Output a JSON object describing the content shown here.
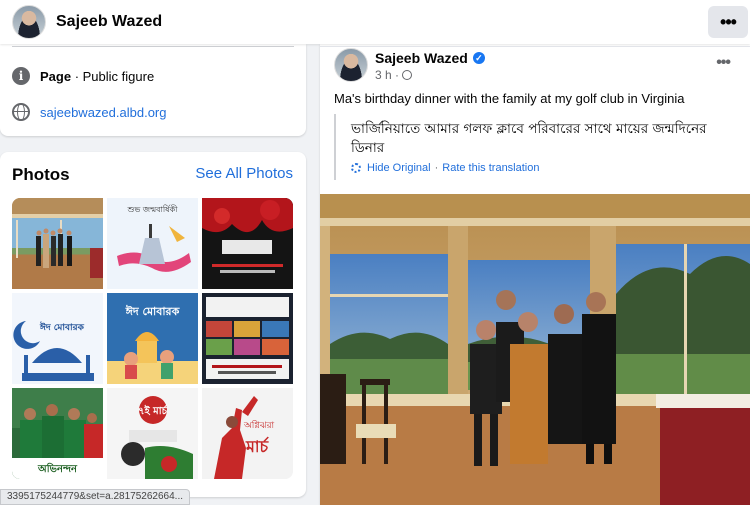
{
  "header": {
    "name": "Sajeeb Wazed",
    "more_label": "•••"
  },
  "intro": {
    "category_label": "Page",
    "category_value": "Public figure",
    "separator": " · ",
    "website": "sajeebwazed.albd.org"
  },
  "photos": {
    "title": "Photos",
    "see_all": "See All Photos",
    "tiles": [
      {
        "name": "photo-family-dinner"
      },
      {
        "name": "photo-birthday-illustration"
      },
      {
        "name": "photo-red-poster"
      },
      {
        "name": "photo-eid-mubarak-mosque"
      },
      {
        "name": "photo-eid-mubarak-family"
      },
      {
        "name": "photo-collage-poster"
      },
      {
        "name": "photo-cricket-team"
      },
      {
        "name": "photo-march-poster"
      },
      {
        "name": "photo-independence-poster"
      }
    ],
    "tile_texts": {
      "birthday": "শুভ জন্মবার্ষিকী",
      "eid": "ঈদ মোবারক",
      "eid2": "ঈদ মোবারক",
      "march": "মার্চ",
      "date": "৭ই মার্চ",
      "cricket": "অভিনন্দন",
      "agnijhara": "অগ্নিঝরা"
    }
  },
  "status_url": "3395175244779&set=a.28175262664...",
  "post": {
    "author": "Sajeeb Wazed",
    "time": "3 h ·",
    "text": "Ma's birthday dinner with the family at my golf club in Virginia",
    "translation": "ভার্জিনিয়াতে আমার গলফ ক্লাবে পরিবারের সাথে মায়ের জন্মদিনের ডিনার",
    "hide_original": "Hide Original",
    "separator": "·",
    "rate_translation": "Rate this translation",
    "more_label": "•••"
  },
  "colors": {
    "link": "#216fdb",
    "verified": "#1877f2",
    "background": "#f0f2f5"
  }
}
